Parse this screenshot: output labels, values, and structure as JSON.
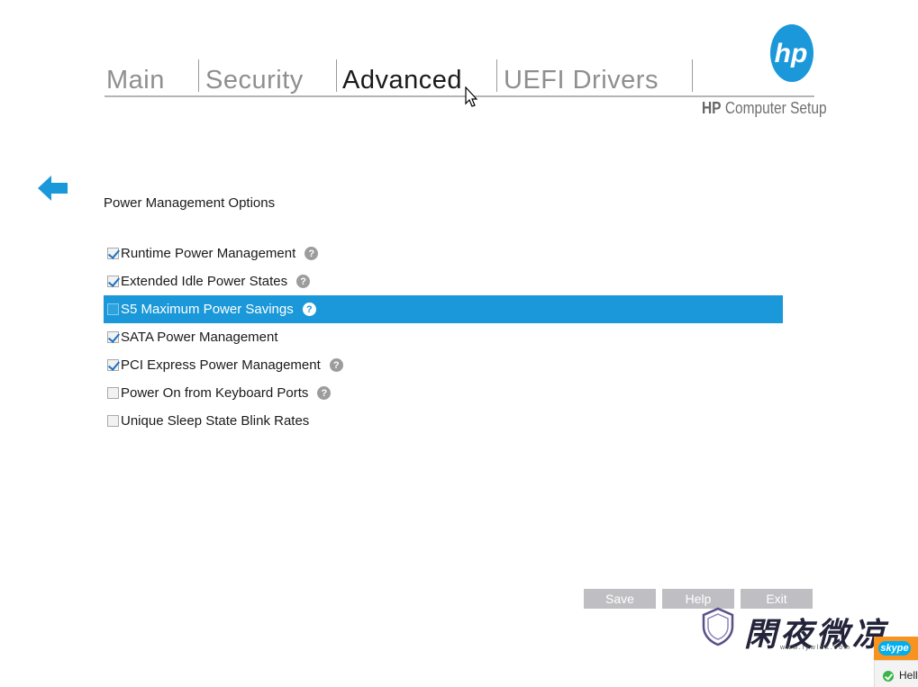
{
  "tabs": [
    {
      "label": "Main",
      "active": false
    },
    {
      "label": "Security",
      "active": false
    },
    {
      "label": "Advanced",
      "active": true
    },
    {
      "label": "UEFI Drivers",
      "active": false
    }
  ],
  "brand": {
    "hp": "HP",
    "product": "Computer Setup"
  },
  "colors": {
    "accent": "#1a98d9",
    "button": "#bfbfc3",
    "checkmark": "#1b72c4"
  },
  "section_title": "Power Management Options",
  "options": [
    {
      "label": "Runtime Power Management",
      "checked": true,
      "help": true,
      "selected": false
    },
    {
      "label": "Extended Idle Power States",
      "checked": true,
      "help": true,
      "selected": false
    },
    {
      "label": "S5 Maximum Power Savings",
      "checked": false,
      "help": true,
      "selected": true
    },
    {
      "label": "SATA Power Management",
      "checked": true,
      "help": false,
      "selected": false
    },
    {
      "label": "PCI Express Power Management",
      "checked": true,
      "help": true,
      "selected": false
    },
    {
      "label": "Power On from Keyboard Ports",
      "checked": false,
      "help": true,
      "selected": false
    },
    {
      "label": "Unique Sleep State Blink Rates",
      "checked": false,
      "help": false,
      "selected": false
    }
  ],
  "buttons": {
    "save": "Save",
    "help": "Help",
    "exit": "Exit"
  },
  "help_glyph": "?",
  "watermark": {
    "text": "閑夜微凉",
    "url": "www.lywlbk.com"
  },
  "skype": {
    "logo": "skype",
    "message": "Hello"
  }
}
